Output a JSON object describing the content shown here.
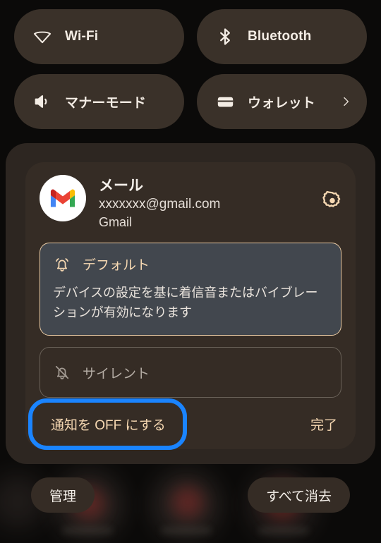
{
  "quick_settings": {
    "tiles": [
      {
        "id": "wifi",
        "label": "Wi-Fi",
        "icon": "wifi-icon",
        "chevron": false
      },
      {
        "id": "bluetooth",
        "label": "Bluetooth",
        "icon": "bluetooth-icon",
        "chevron": false
      },
      {
        "id": "ringmode",
        "label": "マナーモード",
        "icon": "volume-icon",
        "chevron": false
      },
      {
        "id": "wallet",
        "label": "ウォレット",
        "icon": "wallet-icon",
        "chevron": true
      }
    ]
  },
  "notification": {
    "app_name": "メール",
    "account": "xxxxxxx@gmail.com",
    "source": "Gmail",
    "app_icon": "gmail-icon",
    "settings_icon": "gear-icon",
    "options": [
      {
        "id": "default",
        "title": "デフォルト",
        "icon": "bell-ringing-icon",
        "description": "デバイスの設定を基に着信音またはバイブレーションが有効になります",
        "selected": true
      },
      {
        "id": "silent",
        "title": "サイレント",
        "icon": "bell-off-icon",
        "description": "",
        "selected": false
      }
    ],
    "turn_off_label": "通知を OFF にする",
    "done_label": "完了"
  },
  "shade_actions": {
    "manage_label": "管理",
    "clear_all_label": "すべて消去"
  },
  "colors": {
    "background": "#0b0a09",
    "tile_bg": "#3a3129",
    "shade_bg": "#2d2621",
    "card_bg": "#352c25",
    "accent_cream": "#f6d8b2",
    "selected_option_bg": "#42474e",
    "focus_ring": "#1a84ff",
    "text_primary": "#f4efe9"
  }
}
